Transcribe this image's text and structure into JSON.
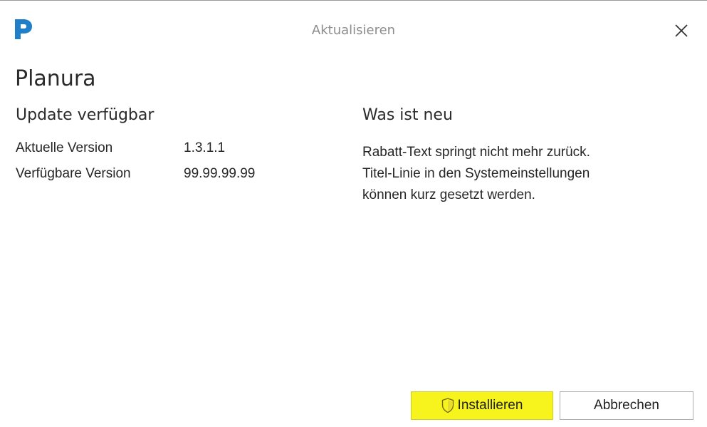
{
  "window": {
    "title": "Aktualisieren"
  },
  "app": {
    "name": "Planura"
  },
  "update": {
    "heading": "Update verfügbar",
    "current_version_label": "Aktuelle Version",
    "current_version_value": "1.3.1.1",
    "available_version_label": "Verfügbare Version",
    "available_version_value": "99.99.99.99"
  },
  "whats_new": {
    "heading": "Was ist neu",
    "text": "Rabatt-Text springt nicht mehr zurück.\nTitel-Linie in den Systemeinstellungen\nkönnen kurz gesetzt werden."
  },
  "buttons": {
    "install_label": "Installieren",
    "cancel_label": "Abbrechen"
  },
  "icons": {
    "logo": "planura-logo-icon",
    "close": "close-icon",
    "install": "shield-icon"
  },
  "colors": {
    "brand": "#1f7fc9",
    "install_highlight": "#f6f41c"
  }
}
